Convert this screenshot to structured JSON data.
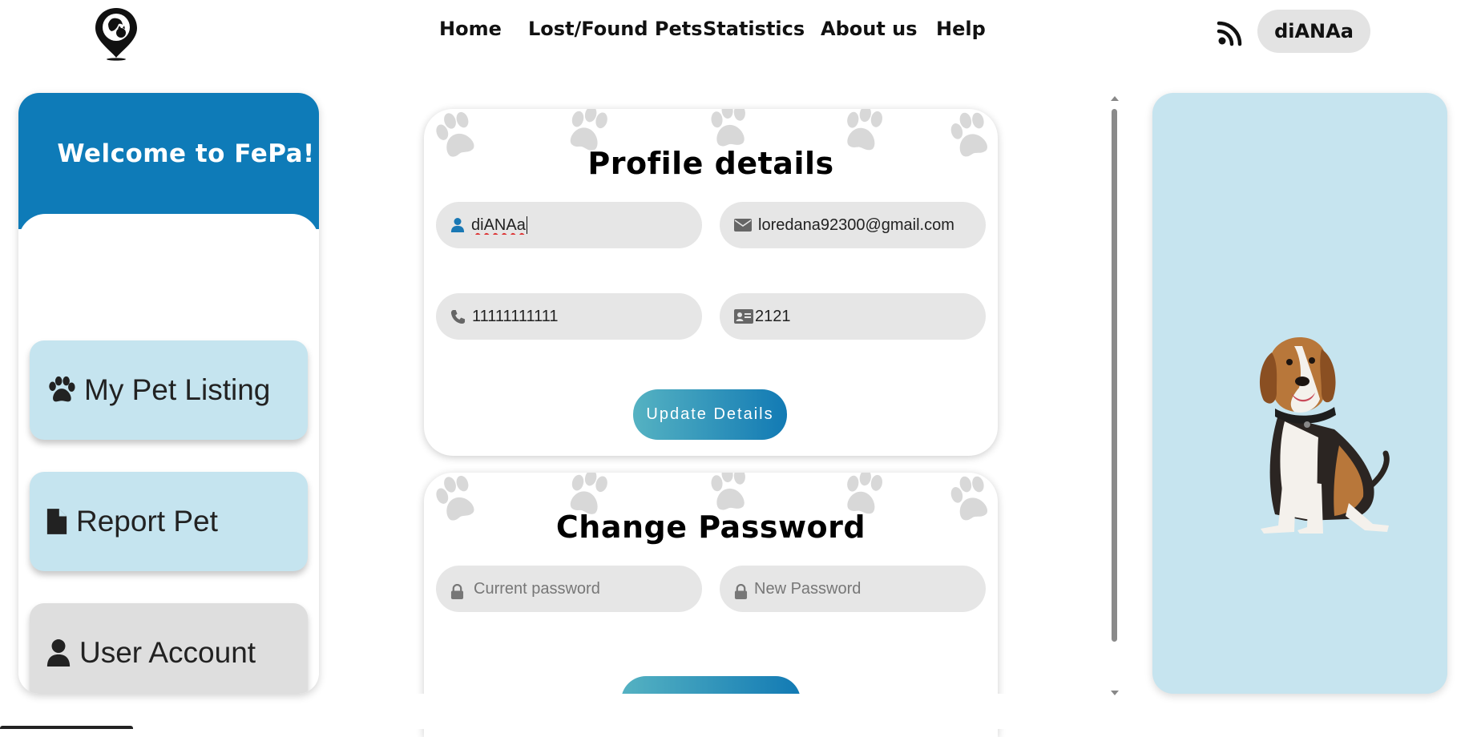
{
  "header": {
    "logo_icon": "pet-location-pin-logo",
    "nav": [
      {
        "label": "Home"
      },
      {
        "label": "Lost/Found Pets"
      },
      {
        "label": "Statistics"
      },
      {
        "label": "About us"
      },
      {
        "label": "Help"
      }
    ],
    "rss_icon": "rss-feed-icon",
    "user_name": "diANAa"
  },
  "sidebar": {
    "title": "Welcome to FePa!",
    "items": [
      {
        "label": "My Pet Listing",
        "icon": "paw-icon"
      },
      {
        "label": "Report Pet",
        "icon": "document-icon"
      },
      {
        "label": "User Account",
        "icon": "user-icon",
        "active": true
      }
    ]
  },
  "profile": {
    "title": "Profile details",
    "username": "diANAa",
    "email": "loredana92300@gmail.com",
    "phone": "11111111111",
    "id_number": "2121",
    "update_label": "Update Details"
  },
  "password": {
    "title": "Change Password",
    "current_placeholder": "Current password",
    "new_placeholder": "New Password"
  },
  "colors": {
    "brand_blue": "#0e7bb8",
    "light_blue": "#c5e4ef",
    "field_gray": "#e6e6e6",
    "button_gradient_start": "#55b2c2",
    "button_gradient_end": "#127ab4"
  }
}
